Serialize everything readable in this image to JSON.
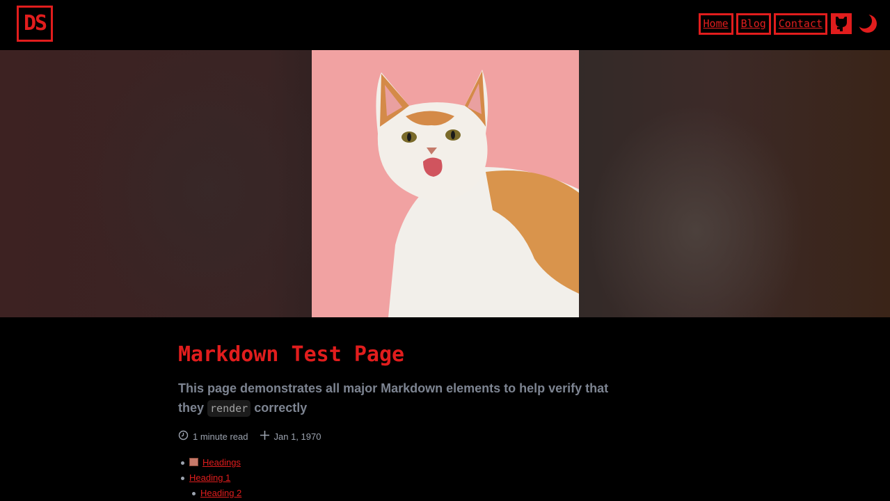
{
  "header": {
    "logo_text": "DS",
    "nav": [
      {
        "label": "Home"
      },
      {
        "label": "Blog"
      },
      {
        "label": "Contact"
      }
    ]
  },
  "post": {
    "title": "Markdown Test Page",
    "description_before": "This page demonstrates all major Markdown elements to help verify that they",
    "description_code": "render",
    "description_after": "correctly",
    "read_time": "1 minute read",
    "date": "Jan 1, 1970"
  },
  "toc": [
    {
      "label": "Headings",
      "emoji": "brick"
    },
    {
      "label": "Heading 1"
    },
    {
      "label": "Heading 2"
    }
  ],
  "colors": {
    "accent": "#e11d1d",
    "background": "#000000",
    "muted_text": "#7d8491"
  },
  "icons": {
    "github": "github-icon",
    "theme": "moon-icon",
    "clock": "clock-icon",
    "plus": "plus-icon"
  }
}
